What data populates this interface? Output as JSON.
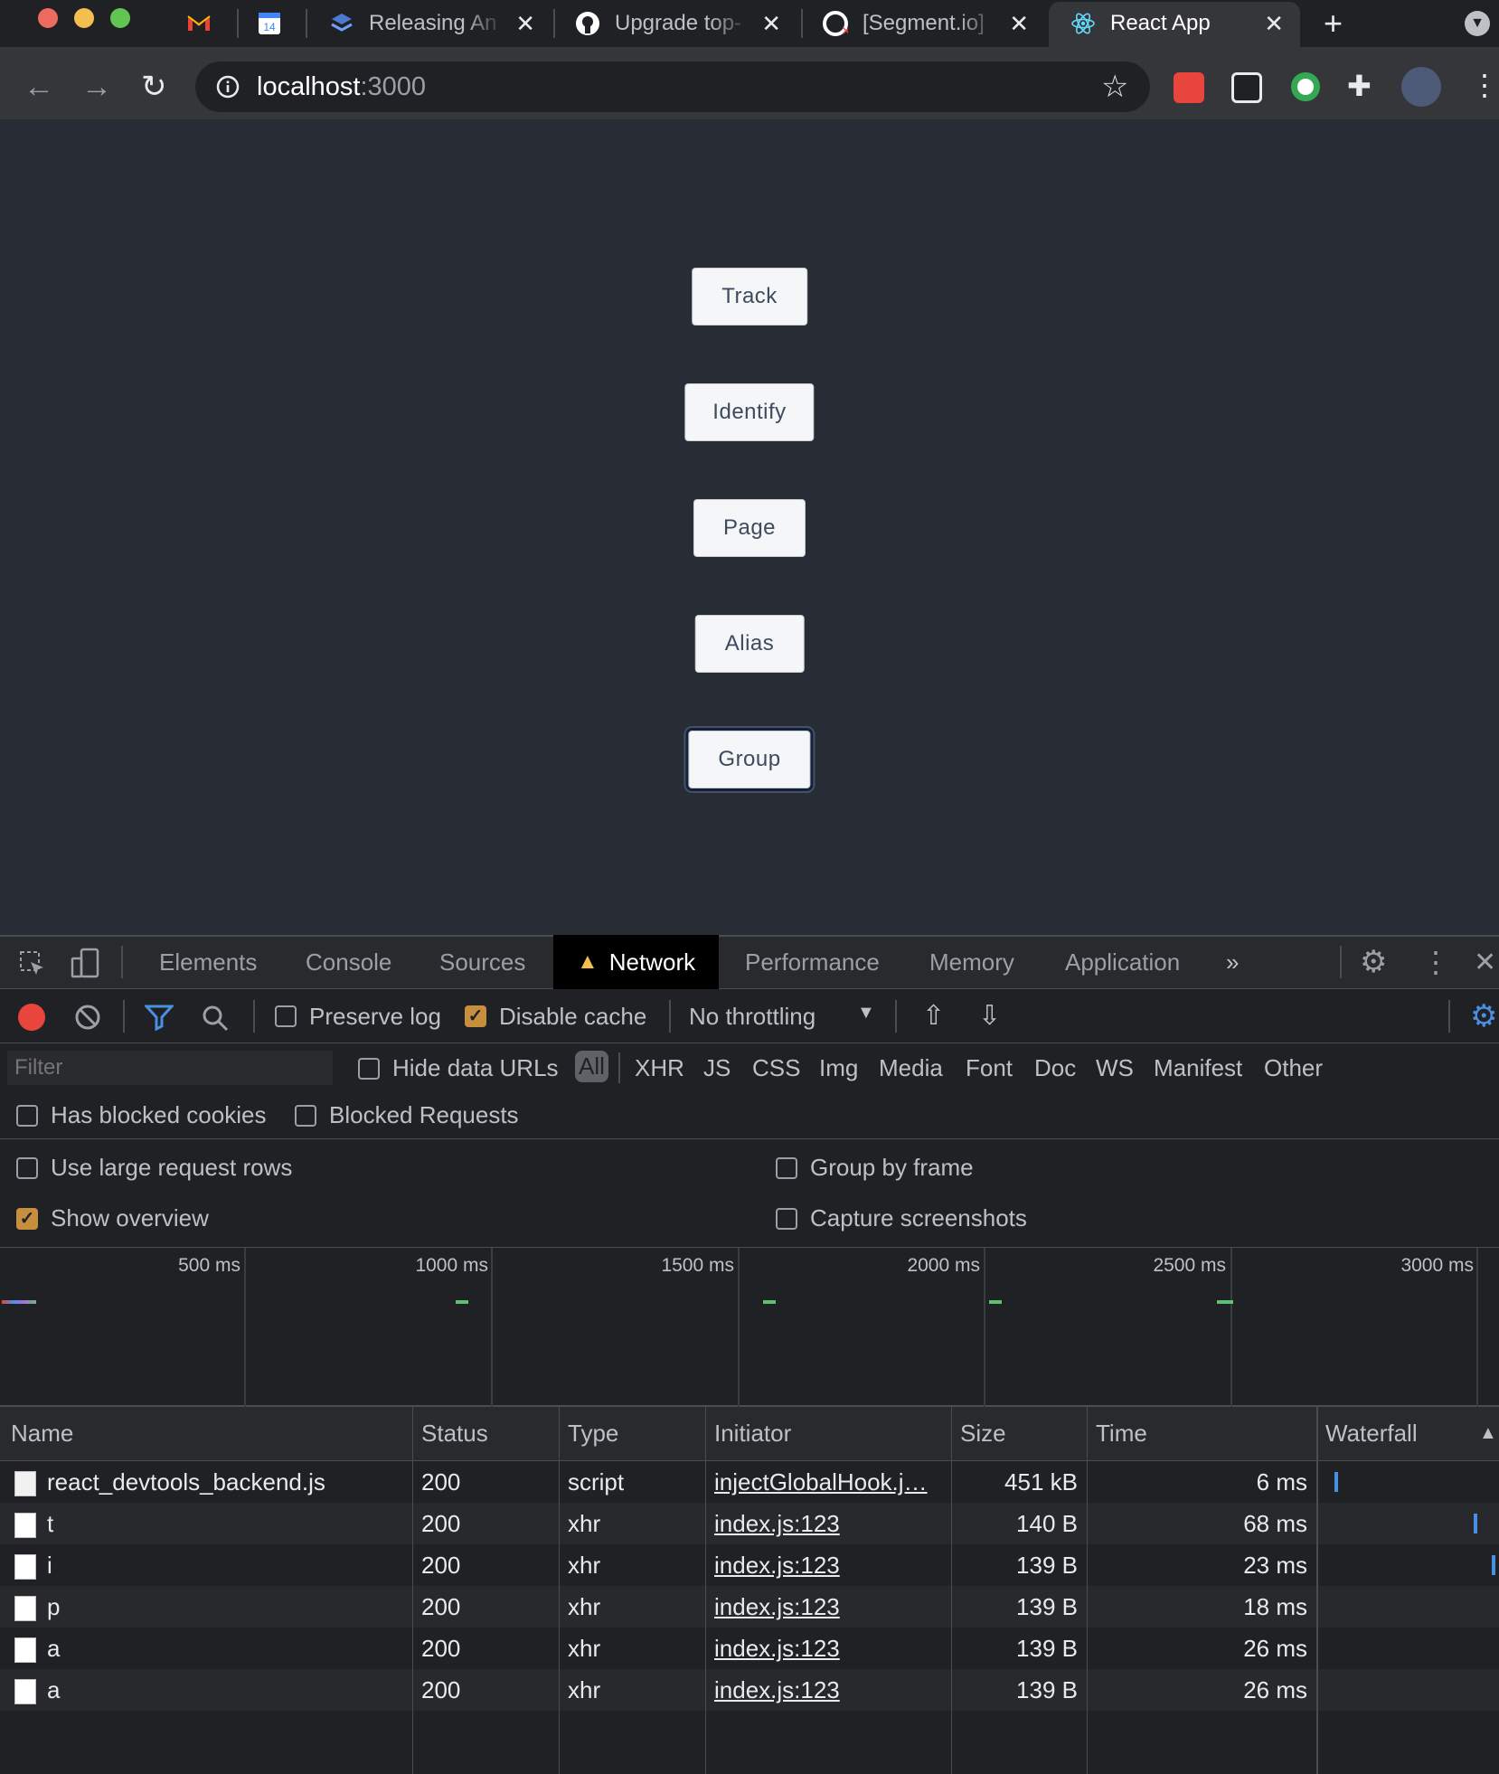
{
  "browser": {
    "tabs": [
      {
        "title": "",
        "icon": "gmail-icon"
      },
      {
        "title": "",
        "icon": "calendar-icon",
        "badge": "14"
      },
      {
        "title": "Releasing An",
        "icon": "stack-icon"
      },
      {
        "title": "Upgrade top-",
        "icon": "github-icon"
      },
      {
        "title": "[Segment.io]",
        "icon": "github-error-icon"
      },
      {
        "title": "React App",
        "icon": "react-icon",
        "active": true
      }
    ],
    "url_host": "localhost",
    "url_port": ":3000"
  },
  "page": {
    "buttons": [
      "Track",
      "Identify",
      "Page",
      "Alias",
      "Group"
    ]
  },
  "devtools": {
    "tabs": [
      "Elements",
      "Console",
      "Sources",
      "Network",
      "Performance",
      "Memory",
      "Application"
    ],
    "active_tab": "Network",
    "netbar": {
      "preserve_log": "Preserve log",
      "disable_cache": "Disable cache",
      "throttling": "No throttling"
    },
    "filter": {
      "placeholder": "Filter",
      "hide_data_urls": "Hide data URLs",
      "types": [
        "All",
        "XHR",
        "JS",
        "CSS",
        "Img",
        "Media",
        "Font",
        "Doc",
        "WS",
        "Manifest",
        "Other"
      ],
      "has_blocked_cookies": "Has blocked cookies",
      "blocked_requests": "Blocked Requests"
    },
    "settings": {
      "large_rows": "Use large request rows",
      "group_by_frame": "Group by frame",
      "show_overview": "Show overview",
      "capture_screenshots": "Capture screenshots"
    },
    "overview_ticks": [
      "500 ms",
      "1000 ms",
      "1500 ms",
      "2000 ms",
      "2500 ms",
      "3000 ms"
    ],
    "columns": [
      "Name",
      "Status",
      "Type",
      "Initiator",
      "Size",
      "Time",
      "Waterfall"
    ],
    "rows": [
      {
        "name": "react_devtools_backend.js",
        "status": "200",
        "type": "script",
        "initiator": "injectGlobalHook.j…",
        "size": "451 kB",
        "time": "6 ms"
      },
      {
        "name": "t",
        "status": "200",
        "type": "xhr",
        "initiator": "index.js:123",
        "size": "140 B",
        "time": "68 ms"
      },
      {
        "name": "i",
        "status": "200",
        "type": "xhr",
        "initiator": "index.js:123",
        "size": "139 B",
        "time": "23 ms"
      },
      {
        "name": "p",
        "status": "200",
        "type": "xhr",
        "initiator": "index.js:123",
        "size": "139 B",
        "time": "18 ms"
      },
      {
        "name": "a",
        "status": "200",
        "type": "xhr",
        "initiator": "index.js:123",
        "size": "139 B",
        "time": "26 ms"
      },
      {
        "name": "a",
        "status": "200",
        "type": "xhr",
        "initiator": "index.js:123",
        "size": "139 B",
        "time": "26 ms"
      }
    ]
  },
  "colors": {
    "page_bg": "#282c34",
    "devtools_bg": "#202124",
    "checkbox_on": "#c68f3e",
    "record_red": "#e8453c",
    "waterfall_blue": "#4a90e2"
  }
}
